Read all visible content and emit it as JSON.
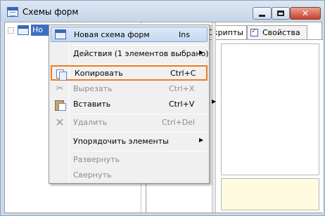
{
  "window": {
    "title": "Схемы форм",
    "close_glyph": "✕"
  },
  "tree": {
    "selected_item_label": "Но"
  },
  "tabs": [
    {
      "label": "Скрипты"
    },
    {
      "label": "Свойства"
    }
  ],
  "context_menu": {
    "items": [
      {
        "label": "Новая схема форм",
        "shortcut": "Ins",
        "icon": "form-icon",
        "state": "hover"
      },
      {
        "label": "Действия (1 элементов выбрано)",
        "submenu": true
      },
      {
        "label": "Копировать",
        "shortcut": "Ctrl+C",
        "icon": "copy-icon",
        "state": "focused"
      },
      {
        "label": "Вырезать",
        "shortcut": "Ctrl+X",
        "icon": "cut-icon",
        "disabled": true
      },
      {
        "label": "Вставить",
        "shortcut": "Ctrl+V",
        "icon": "paste-icon"
      },
      {
        "label": "Удалить",
        "shortcut": "Ctrl+Del",
        "icon": "delete-icon",
        "disabled": true
      },
      {
        "label": "Упорядочить элементы",
        "submenu": true
      },
      {
        "label": "Развернуть",
        "disabled": true
      },
      {
        "label": "Свернуть",
        "disabled": true
      }
    ],
    "submenu_arrow": "▶",
    "focus_color": "#f07b22",
    "hover_color": "#c3d8f1"
  },
  "splitter_arrow": "▶",
  "help_background": "#fffbe0"
}
